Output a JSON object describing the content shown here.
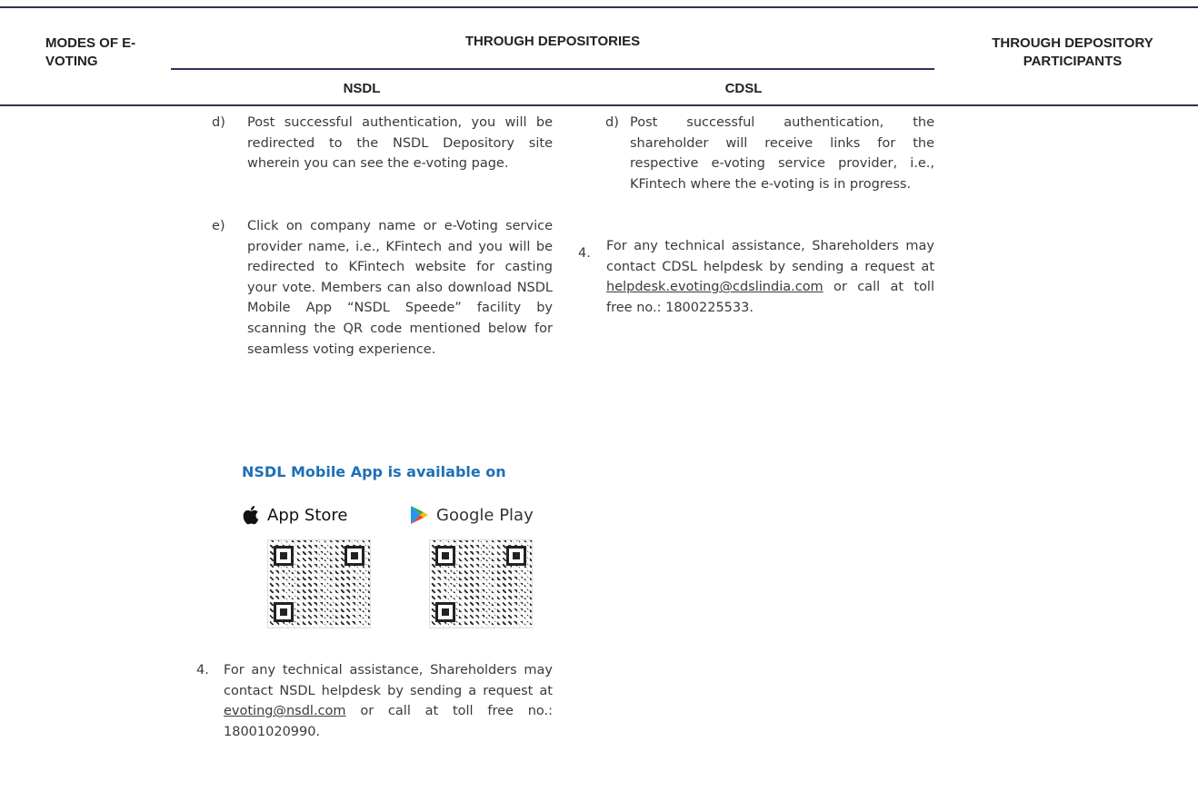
{
  "header": {
    "col_modes": "MODES OF E-VOTING",
    "col_depositories": "THROUGH DEPOSITORIES",
    "col_participants": "THROUGH DEPOSITORY PARTICIPANTS",
    "sub_nsdl": "NSDL",
    "sub_cdsl": "CDSL"
  },
  "nsdl": {
    "item_d": {
      "marker": "d)",
      "text": "Post successful authentication, you will be redirected to the NSDL Depository site wherein you can see the e-voting page."
    },
    "item_e": {
      "marker": "e)",
      "text": "Click on company name or e-Voting service provider name, i.e., KFintech and you will be redirected to KFintech website for casting your vote. Members can also download NSDL Mobile App “NSDL Speede” facility by scanning the QR code mentioned below for seamless voting experience."
    },
    "app_banner": {
      "title": "NSDL Mobile App is available on",
      "app_store": "App Store",
      "google_play": "Google Play",
      "apple_color": "#111111",
      "title_color": "#1f6fb5"
    },
    "item_4": {
      "marker": "4.",
      "text_before": "For any technical assistance, Shareholders may contact NSDL helpdesk by sending a request at",
      "email": "evoting@nsdl.com",
      "text_after": "or call at toll free no.: 18001020990."
    }
  },
  "cdsl": {
    "item_d": {
      "marker": "d)",
      "text": "Post successful authentication, the shareholder will receive links for the respective e-voting service provider, i.e., KFintech where the e-voting is in progress."
    },
    "item_4": {
      "marker": "4.",
      "text_before": "For any technical assistance, Shareholders may contact CDSL helpdesk by sending a request at",
      "email": "helpdesk.evoting@cdslindia.com",
      "text_after": "or call at toll free no.: 1800225533."
    }
  },
  "colors": {
    "rule": "#3b2a5c"
  }
}
